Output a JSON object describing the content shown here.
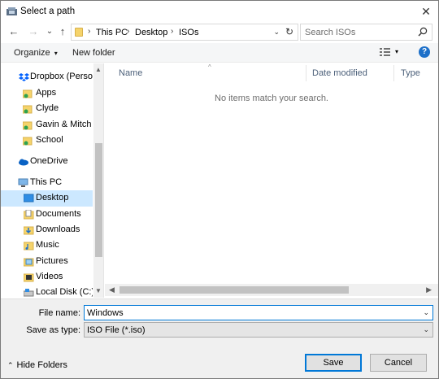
{
  "window": {
    "title": "Select a path",
    "close_glyph": "✕"
  },
  "nav": {
    "back_glyph": "←",
    "forward_glyph": "→",
    "recent_glyph": "⌄",
    "up_glyph": "↑",
    "breadcrumb": [
      "This PC",
      "Desktop",
      "ISOs"
    ],
    "separator": "›",
    "dropdown_glyph": "⌄",
    "refresh_glyph": "↻"
  },
  "search": {
    "placeholder": "Search ISOs"
  },
  "toolbar": {
    "organize_label": "Organize",
    "organize_caret": "▾",
    "new_folder_label": "New folder",
    "view_caret": "▾",
    "help_label": "?"
  },
  "sidebar": {
    "up_glyph": "▲",
    "down_glyph": "▼",
    "items": [
      {
        "label": "Dropbox (Persona",
        "icon": "dropbox-icon"
      },
      {
        "label": "Apps",
        "icon": "shared-folder-icon"
      },
      {
        "label": "Clyde",
        "icon": "shared-folder-icon"
      },
      {
        "label": "Gavin & Mitch",
        "icon": "shared-folder-icon"
      },
      {
        "label": "School",
        "icon": "shared-folder-icon"
      },
      {
        "label": "OneDrive",
        "icon": "onedrive-icon"
      },
      {
        "label": "This PC",
        "icon": "computer-icon"
      },
      {
        "label": "Desktop",
        "icon": "desktop-icon",
        "selected": true
      },
      {
        "label": "Documents",
        "icon": "documents-icon"
      },
      {
        "label": "Downloads",
        "icon": "downloads-icon"
      },
      {
        "label": "Music",
        "icon": "music-icon"
      },
      {
        "label": "Pictures",
        "icon": "pictures-icon"
      },
      {
        "label": "Videos",
        "icon": "videos-icon"
      },
      {
        "label": "Local Disk (C:)",
        "icon": "local-disk-icon"
      }
    ]
  },
  "file_list": {
    "columns": [
      "Name",
      "Date modified",
      "Type"
    ],
    "sort_glyph": "^",
    "empty_message": "No items match your search.",
    "scroll_left_glyph": "◀",
    "scroll_right_glyph": "▶"
  },
  "form": {
    "file_name_label": "File name:",
    "file_name_value": "Windows",
    "save_type_label": "Save as type:",
    "save_type_value": "ISO File (*.iso)",
    "dropdown_glyph": "⌄"
  },
  "footer": {
    "hide_folders_label": "Hide Folders",
    "hide_folders_glyph": "⌃",
    "save_label": "Save",
    "cancel_label": "Cancel"
  },
  "colors": {
    "accent": "#0078d7",
    "selection": "#cce8ff",
    "help": "#1e70c9"
  }
}
